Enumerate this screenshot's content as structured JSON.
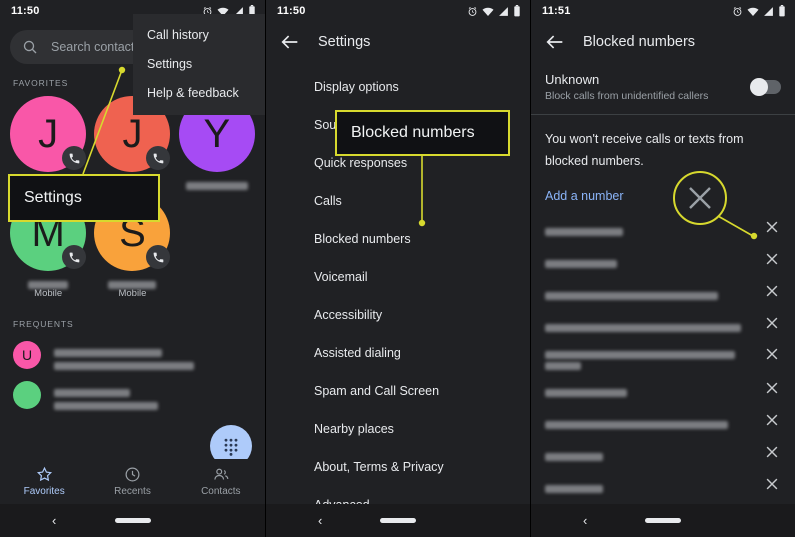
{
  "panels": [
    {
      "id": "dialer-favorites",
      "status": {
        "time": "11:50",
        "icons": [
          "alarm-icon",
          "wifi-icon",
          "signal-icon",
          "battery-icon"
        ]
      },
      "search": {
        "placeholder": "Search contact",
        "icon": "search-icon"
      },
      "sections": {
        "favorites_label": "FAVORITES",
        "frequents_label": "FREQUENTS"
      },
      "favorites": [
        {
          "initial": "J",
          "color": "#f957a8",
          "sub": "",
          "redacted_name": true
        },
        {
          "initial": "J",
          "color": "#ef6250",
          "sub": "",
          "redacted_name": true
        },
        {
          "initial": "Y",
          "color": "#a64bf4",
          "sub": "",
          "redacted_name": true
        },
        {
          "initial": "M",
          "color": "#5bd07f",
          "sub": "Mobile",
          "redacted_name": true
        },
        {
          "initial": "S",
          "color": "#f9a23b",
          "sub": "Mobile",
          "redacted_name": true
        }
      ],
      "frequents": [
        {
          "initial": "U",
          "color": "#f957a8",
          "redacted": true
        },
        {
          "initial": "",
          "color": "#5bd07f",
          "redacted": true
        }
      ],
      "fab": {
        "name": "dialpad-fab"
      },
      "bottom_nav": [
        {
          "label": "Favorites",
          "icon": "star-icon",
          "active": true
        },
        {
          "label": "Recents",
          "icon": "clock-icon",
          "active": false
        },
        {
          "label": "Contacts",
          "icon": "people-icon",
          "active": false
        }
      ],
      "menu": {
        "items": [
          "Call history",
          "Settings",
          "Help & feedback"
        ]
      },
      "annotation": {
        "label": "Settings"
      }
    },
    {
      "id": "settings",
      "status": {
        "time": "11:50",
        "icons": [
          "alarm-icon",
          "wifi-icon",
          "signal-icon",
          "battery-icon"
        ]
      },
      "appbar": {
        "title": "Settings",
        "back_icon": "back-arrow-icon"
      },
      "items": [
        "Display options",
        "Sounds and vibration",
        "Quick responses",
        "Calls",
        "Blocked numbers",
        "Voicemail",
        "Accessibility",
        "Assisted dialing",
        "Spam and Call Screen",
        "Nearby places",
        "About, Terms & Privacy",
        "Advanced"
      ],
      "annotation": {
        "label": "Blocked numbers"
      }
    },
    {
      "id": "blocked-numbers",
      "status": {
        "time": "11:51",
        "icons": [
          "alarm-icon",
          "wifi-icon",
          "signal-icon",
          "battery-icon"
        ]
      },
      "appbar": {
        "title": "Blocked numbers",
        "back_icon": "back-arrow-icon"
      },
      "unknown": {
        "title": "Unknown",
        "subtitle": "Block calls from unidentified callers",
        "toggle_on": false
      },
      "note": "You won't receive calls or texts from blocked numbers.",
      "add_link": "Add a number",
      "blocked_entries": [
        {
          "lines": 1,
          "widths": [
            58
          ],
          "redacted": true
        },
        {
          "lines": 1,
          "widths": [
            40
          ],
          "redacted": true
        },
        {
          "lines": 1,
          "widths": [
            77
          ],
          "redacted": true
        },
        {
          "lines": 1,
          "widths": [
            89
          ],
          "redacted": true
        },
        {
          "lines": 2,
          "widths": [
            88,
            22
          ],
          "redacted": true
        },
        {
          "lines": 1,
          "widths": [
            52
          ],
          "redacted": true
        },
        {
          "lines": 1,
          "widths": [
            82
          ],
          "redacted": true
        },
        {
          "lines": 1,
          "widths": [
            32
          ],
          "redacted": true
        },
        {
          "lines": 1,
          "widths": [
            32
          ],
          "redacted": true
        }
      ],
      "row_remove_icon": "close-x-icon",
      "annotation": {
        "highlight_icon": "close-x-icon"
      }
    }
  ],
  "theme": {
    "annotation_color": "#d7d92e",
    "background": "#202124",
    "accent_blue": "#8ab4f8",
    "fab_blue": "#aecbfa"
  },
  "sysnav": {
    "back_icon": "chevron-left-icon",
    "home_pill": "home-pill"
  }
}
